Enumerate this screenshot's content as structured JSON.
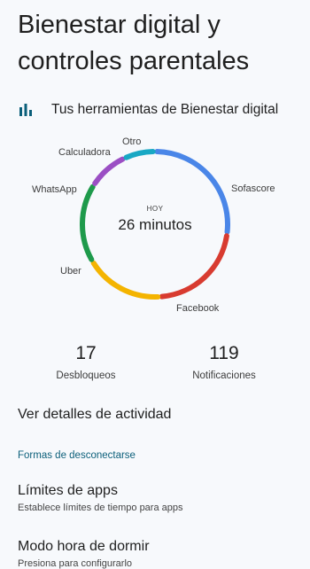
{
  "header": {
    "title": "Bienestar digital y controles parentales"
  },
  "tools_section": {
    "icon": "bar-chart-icon",
    "label": "Tus herramientas de Bienestar digital"
  },
  "chart_data": {
    "type": "pie",
    "donut": true,
    "center_caption": "HOY",
    "center_value": "26 minutos",
    "segments": [
      {
        "label": "Sofascore",
        "value": 0.255,
        "color": "#4a86e8"
      },
      {
        "label": "Facebook",
        "value": 0.205,
        "color": "#d83b30"
      },
      {
        "label": "Uber",
        "value": 0.165,
        "color": "#f4b400"
      },
      {
        "label": "WhatsApp",
        "value": 0.165,
        "color": "#1e9a4b"
      },
      {
        "label": "Calculadora",
        "value": 0.085,
        "color": "#9b4fc4"
      },
      {
        "label": "Otro",
        "value": 0.065,
        "color": "#18a8c4"
      }
    ]
  },
  "stats": {
    "unlocks": {
      "value": "17",
      "label": "Desbloqueos"
    },
    "notifications": {
      "value": "119",
      "label": "Notificaciones"
    }
  },
  "activity": {
    "label": "Ver detalles de actividad"
  },
  "disconnect": {
    "header": "Formas de desconectarse",
    "items": [
      {
        "title": "Límites de apps",
        "subtitle": "Establece límites de tiempo para apps"
      },
      {
        "title": "Modo hora de dormir",
        "subtitle": "Presiona para configurarlo"
      }
    ]
  }
}
